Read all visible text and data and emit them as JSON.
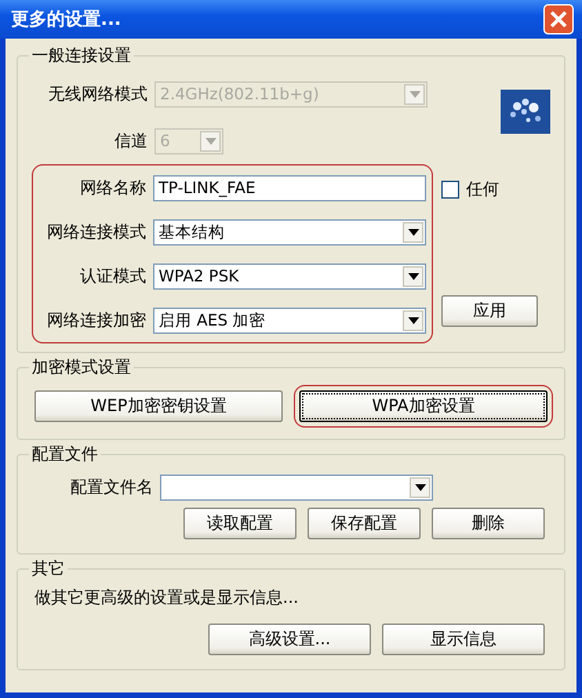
{
  "window": {
    "title": "更多的设置..."
  },
  "general": {
    "title": "一般连接设置",
    "wireless_mode": {
      "label": "无线网络模式",
      "value": "2.4GHz(802.11b+g)",
      "disabled": true
    },
    "channel": {
      "label": "信道",
      "value": "6",
      "disabled": true
    },
    "highlighted_fields": [
      {
        "kind": "text",
        "label": "网络名称",
        "value": "TP-LINK_FAE",
        "disabled": false
      },
      {
        "kind": "dropdown",
        "label": "网络连接模式",
        "value": "基本结构",
        "disabled": false
      },
      {
        "kind": "dropdown",
        "label": "认证模式",
        "value": "WPA2 PSK",
        "disabled": false
      },
      {
        "kind": "dropdown",
        "label": "网络连接加密",
        "value": "启用 AES 加密",
        "disabled": false
      }
    ],
    "any_checkbox": {
      "label": "任何",
      "checked": false
    },
    "apply_button": "应用"
  },
  "encryption": {
    "title": "加密模式设置",
    "buttons": [
      {
        "label": "WEP加密密钥设置",
        "highlighted": false
      },
      {
        "label": "WPA加密设置",
        "highlighted": true
      }
    ]
  },
  "profile": {
    "title": "配置文件",
    "field_label": "配置文件名",
    "buttons": [
      "读取配置",
      "保存配置",
      "删除"
    ]
  },
  "other": {
    "title": "其它",
    "description": "做其它更高级的设置或是显示信息...",
    "buttons": [
      "高级设置...",
      "显示信息"
    ]
  }
}
